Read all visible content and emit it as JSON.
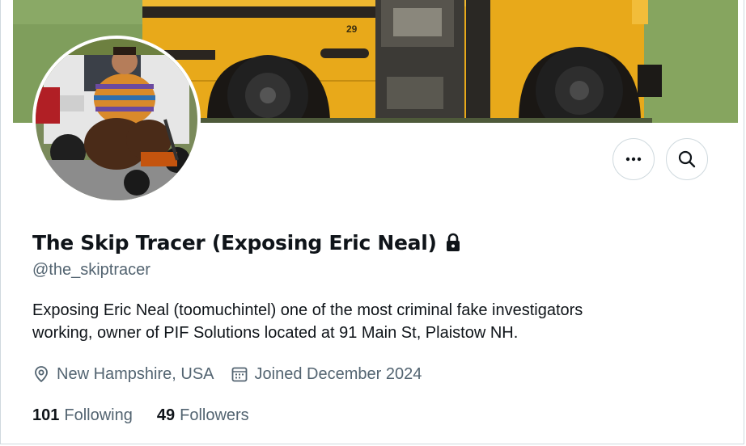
{
  "profile": {
    "display_name": "The Skip Tracer (Exposing Eric Neal)",
    "handle": "@the_skiptracer",
    "bio_lines": [
      "Exposing Eric Neal (toomuchintel) one of the most criminal fake investigators",
      "working, owner of PIF Solutions located at 91 Main St, Plaistow NH."
    ],
    "location": "New Hampshire, USA",
    "joined": "Joined December 2024",
    "following_count": "101",
    "following_label": "Following",
    "followers_count": "49",
    "followers_label": "Followers",
    "protected_icon": "lock-icon"
  },
  "banner": {
    "bus_number": "29"
  },
  "actions": {
    "more_icon": "more-horizontal-icon",
    "search_icon": "search-icon"
  },
  "colors": {
    "text_primary": "#0f1419",
    "text_secondary": "#536471",
    "border": "#cfd9de",
    "bus_yellow": "#e8a91a"
  }
}
